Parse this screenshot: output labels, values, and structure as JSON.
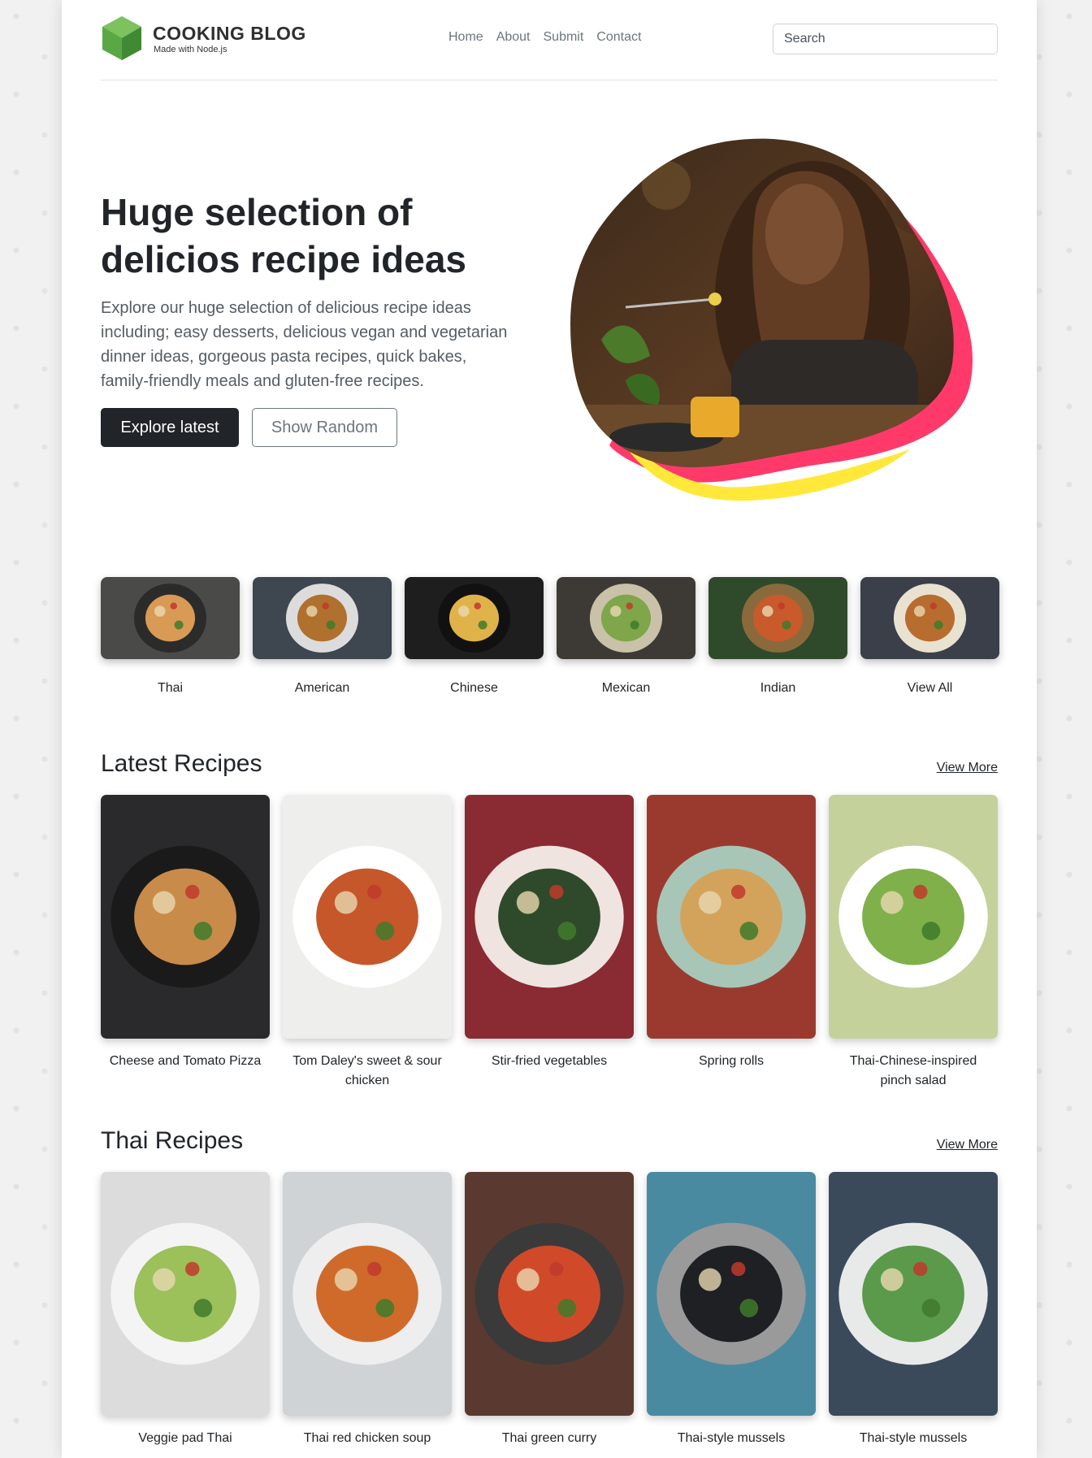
{
  "brand": {
    "title": "COOKING BLOG",
    "subtitle": "Made with Node.js"
  },
  "nav": [
    "Home",
    "About",
    "Submit",
    "Contact"
  ],
  "search": {
    "placeholder": "Search"
  },
  "hero": {
    "title": "Huge selection of delicios recipe ideas",
    "lead": "Explore our huge selection of delicious recipe ideas including; easy desserts, delicious vegan and vegetarian dinner ideas, gorgeous pasta recipes, quick bakes, family-friendly meals and gluten-free recipes.",
    "primary_button": "Explore latest",
    "secondary_button": "Show Random"
  },
  "categories": [
    {
      "label": "Thai",
      "bg": "#4a4a48",
      "plate": "#2b2b2b",
      "food": "#d99a55"
    },
    {
      "label": "American",
      "bg": "#3e4650",
      "plate": "#dcdcdc",
      "food": "#b0702e"
    },
    {
      "label": "Chinese",
      "bg": "#1e1e1e",
      "plate": "#111111",
      "food": "#e0b34a"
    },
    {
      "label": "Mexican",
      "bg": "#3d3a35",
      "plate": "#c9c2a8",
      "food": "#7fa64a"
    },
    {
      "label": "Indian",
      "bg": "#2f4a2a",
      "plate": "#8a6a3c",
      "food": "#c85a2c"
    },
    {
      "label": "View All",
      "bg": "#3a3f4a",
      "plate": "#e9e2d0",
      "food": "#b86c2e"
    }
  ],
  "latest": {
    "title": "Latest Recipes",
    "view_more": "View More",
    "items": [
      {
        "label": "Cheese and Tomato Pizza",
        "bg": "#2a2a2c",
        "plate": "#1a1a1a",
        "food": "#c98b4a"
      },
      {
        "label": "Tom Daley's sweet & sour chicken",
        "bg": "#eeeeec",
        "plate": "#ffffff",
        "food": "#c5572b"
      },
      {
        "label": "Stir-fried vegetables",
        "bg": "#8a2a33",
        "plate": "#efe4e0",
        "food": "#2f4a2a"
      },
      {
        "label": "Spring rolls",
        "bg": "#9a3a2e",
        "plate": "#a7c6b8",
        "food": "#d3a35b"
      },
      {
        "label": "Thai-Chinese-inspired pinch salad",
        "bg": "#c4d19a",
        "plate": "#ffffff",
        "food": "#7fb04a"
      }
    ]
  },
  "thai": {
    "title": "Thai Recipes",
    "view_more": "View More",
    "items": [
      {
        "label": "Veggie pad Thai",
        "bg": "#dcdcdc",
        "plate": "#f4f4f4",
        "food": "#9cc05a"
      },
      {
        "label": "Thai red chicken soup",
        "bg": "#cfd3d6",
        "plate": "#eeeeee",
        "food": "#d06a2a"
      },
      {
        "label": "Thai green curry",
        "bg": "#5a3a30",
        "plate": "#3a3a3a",
        "food": "#d04a2a"
      },
      {
        "label": "Thai-style mussels",
        "bg": "#4a8aa0",
        "plate": "#9a9a9a",
        "food": "#1e2024"
      },
      {
        "label": "Thai-style mussels",
        "bg": "#3a4a5a",
        "plate": "#e8eaea",
        "food": "#5a9a4a"
      }
    ]
  },
  "colors": {
    "dark": "#212529",
    "muted": "#6c757d",
    "logo_green": "#5aa845",
    "blob_pink": "#ff3a6a",
    "blob_yellow": "#ffe83a"
  }
}
